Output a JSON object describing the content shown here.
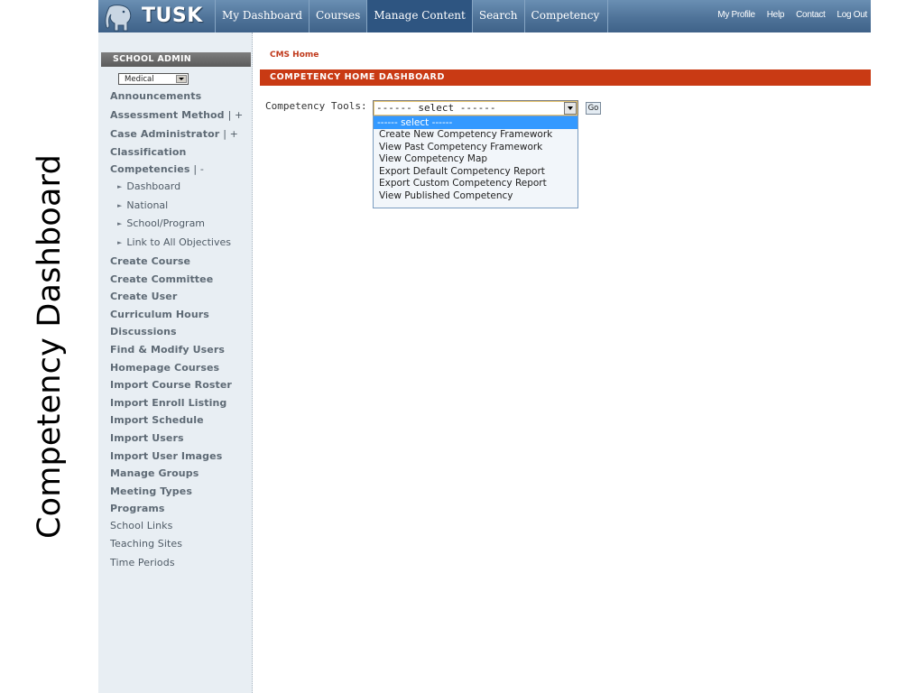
{
  "slide": {
    "title": "Competency Dashboard"
  },
  "app": {
    "logo": "TUSK"
  },
  "nav": {
    "items": [
      "My Dashboard",
      "Courses",
      "Manage Content",
      "Search",
      "Competency"
    ],
    "active": "Manage Content",
    "utility": [
      "My Profile",
      "Help",
      "Contact",
      "Log Out"
    ]
  },
  "sidebar": {
    "header": "SCHOOL ADMIN",
    "school_select": "Medical",
    "items": [
      {
        "label": "Announcements"
      },
      {
        "label": "Assessment Method",
        "suffix": "| +"
      },
      {
        "label": "Case Administrator",
        "suffix": "| +"
      },
      {
        "label": "Classification"
      },
      {
        "label": "Competencies",
        "suffix": "| -"
      },
      {
        "label": "Dashboard"
      },
      {
        "label": "National"
      },
      {
        "label": "School/Program"
      },
      {
        "label": "Link to All Objectives"
      },
      {
        "label": "Create Course"
      },
      {
        "label": "Create Committee"
      },
      {
        "label": "Create User"
      },
      {
        "label": "Curriculum Hours"
      },
      {
        "label": "Discussions"
      },
      {
        "label": "Find & Modify Users"
      },
      {
        "label": "Homepage Courses"
      },
      {
        "label": "Import Course Roster"
      },
      {
        "label": "Import Enroll Listing"
      },
      {
        "label": "Import Schedule"
      },
      {
        "label": "Import Users"
      },
      {
        "label": "Import User Images"
      },
      {
        "label": "Manage Groups"
      },
      {
        "label": "Meeting Types"
      },
      {
        "label": "Programs"
      },
      {
        "label": "School Links"
      },
      {
        "label": "Teaching Sites"
      },
      {
        "label": "Time Periods"
      }
    ]
  },
  "main": {
    "breadcrumb": "CMS Home",
    "title": "COMPETENCY HOME DASHBOARD",
    "tools_label": "Competency Tools:",
    "select_value": "------ select ------",
    "go_label": "Go",
    "options": [
      "------ select ------",
      "Create New Competency Framework",
      "View Past Competency Framework",
      "View Competency Map",
      "Export Default Competency Report",
      "Export Custom Competency Report",
      "View Published Competency"
    ]
  }
}
